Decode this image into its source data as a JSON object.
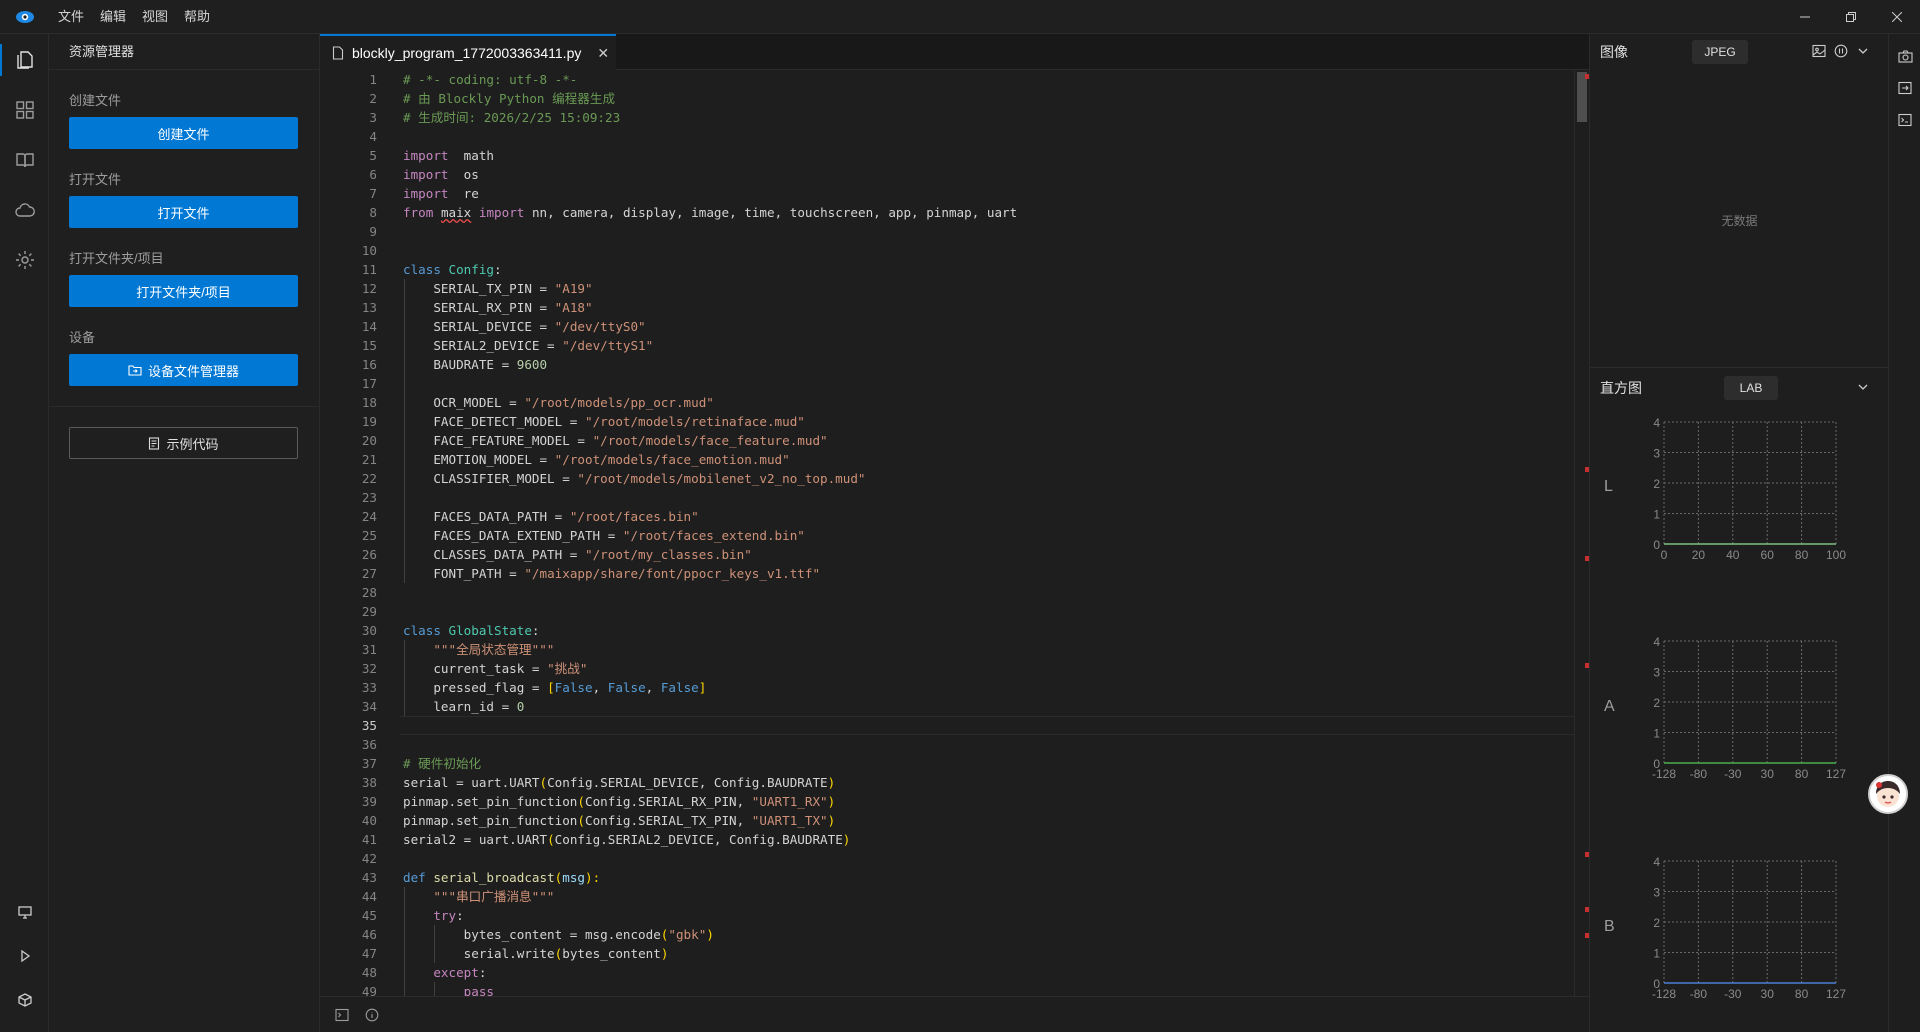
{
  "menu": [
    "文件",
    "编辑",
    "视图",
    "帮助"
  ],
  "sidebar": {
    "title": "资源管理器",
    "sections": [
      {
        "label": "创建文件",
        "button": "创建文件"
      },
      {
        "label": "打开文件",
        "button": "打开文件"
      },
      {
        "label": "打开文件夹/项目",
        "button": "打开文件夹/项目"
      },
      {
        "label": "设备",
        "button": "设备文件管理器"
      }
    ],
    "example_button": "示例代码"
  },
  "editor": {
    "tab_title": "blockly_program_1772003363411.py",
    "current_line": 35,
    "lines": [
      [
        [
          "com",
          "# -*- coding: utf-8 -*-"
        ]
      ],
      [
        [
          "com",
          "# 由 Blockly Python 编程器生成"
        ]
      ],
      [
        [
          "com",
          "# 生成时间: 2026/2/25 15:09:23"
        ]
      ],
      [],
      [
        [
          "kw2",
          "import"
        ],
        [
          "",
          "  math"
        ]
      ],
      [
        [
          "kw2",
          "import"
        ],
        [
          "",
          "  os"
        ]
      ],
      [
        [
          "kw2",
          "import"
        ],
        [
          "",
          "  re"
        ]
      ],
      [
        [
          "kw2",
          "from"
        ],
        [
          "",
          " "
        ],
        [
          "squig",
          "maix"
        ],
        [
          "",
          " "
        ],
        [
          "kw2",
          "import"
        ],
        [
          "",
          " nn, camera, display, image, time, touchscreen, app, pinmap, uart"
        ]
      ],
      [],
      [],
      [
        [
          "kw",
          "class"
        ],
        [
          "",
          " "
        ],
        [
          "cls",
          "Config"
        ],
        [
          "",
          ":"
        ]
      ],
      [
        [
          "",
          "    SERIAL_TX_PIN = "
        ],
        [
          "str",
          "\"A19\""
        ]
      ],
      [
        [
          "",
          "    SERIAL_RX_PIN = "
        ],
        [
          "str",
          "\"A18\""
        ]
      ],
      [
        [
          "",
          "    SERIAL_DEVICE = "
        ],
        [
          "str",
          "\"/dev/ttyS0\""
        ]
      ],
      [
        [
          "",
          "    SERIAL2_DEVICE = "
        ],
        [
          "str",
          "\"/dev/ttyS1\""
        ]
      ],
      [
        [
          "",
          "    BAUDRATE = "
        ],
        [
          "num",
          "9600"
        ]
      ],
      [],
      [
        [
          "",
          "    OCR_MODEL = "
        ],
        [
          "str",
          "\"/root/models/pp_ocr.mud\""
        ]
      ],
      [
        [
          "",
          "    FACE_DETECT_MODEL = "
        ],
        [
          "str",
          "\"/root/models/retinaface.mud\""
        ]
      ],
      [
        [
          "",
          "    FACE_FEATURE_MODEL = "
        ],
        [
          "str",
          "\"/root/models/face_feature.mud\""
        ]
      ],
      [
        [
          "",
          "    EMOTION_MODEL = "
        ],
        [
          "str",
          "\"/root/models/face_emotion.mud\""
        ]
      ],
      [
        [
          "",
          "    CLASSIFIER_MODEL = "
        ],
        [
          "str",
          "\"/root/models/mobilenet_v2_no_top.mud\""
        ]
      ],
      [],
      [
        [
          "",
          "    FACES_DATA_PATH = "
        ],
        [
          "str",
          "\"/root/faces.bin\""
        ]
      ],
      [
        [
          "",
          "    FACES_DATA_EXTEND_PATH = "
        ],
        [
          "str",
          "\"/root/faces_extend.bin\""
        ]
      ],
      [
        [
          "",
          "    CLASSES_DATA_PATH = "
        ],
        [
          "str",
          "\"/root/my_classes.bin\""
        ]
      ],
      [
        [
          "",
          "    FONT_PATH = "
        ],
        [
          "str",
          "\"/maixapp/share/font/ppocr_keys_v1.ttf\""
        ]
      ],
      [],
      [],
      [
        [
          "kw",
          "class"
        ],
        [
          "",
          " "
        ],
        [
          "cls",
          "GlobalState"
        ],
        [
          "",
          ":"
        ]
      ],
      [
        [
          "str",
          "    \"\"\"全局状态管理\"\"\""
        ]
      ],
      [
        [
          "",
          "    current_task = "
        ],
        [
          "str",
          "\"挑战\""
        ]
      ],
      [
        [
          "",
          "    pressed_flag = "
        ],
        [
          "br",
          "["
        ],
        [
          "kw",
          "False"
        ],
        [
          "",
          ", "
        ],
        [
          "kw",
          "False"
        ],
        [
          "",
          ", "
        ],
        [
          "kw",
          "False"
        ],
        [
          "br",
          "]"
        ]
      ],
      [
        [
          "",
          "    learn_id = "
        ],
        [
          "num",
          "0"
        ]
      ],
      [],
      [],
      [
        [
          "com",
          "# 硬件初始化"
        ]
      ],
      [
        [
          "",
          "serial = uart.UART"
        ],
        [
          "br",
          "("
        ],
        [
          "",
          "Config.SERIAL_DEVICE, Config.BAUDRATE"
        ],
        [
          "br",
          ")"
        ]
      ],
      [
        [
          "",
          "pinmap.set_pin_function"
        ],
        [
          "br",
          "("
        ],
        [
          "",
          "Config.SERIAL_RX_PIN, "
        ],
        [
          "str",
          "\"UART1_RX\""
        ],
        [
          "br",
          ")"
        ]
      ],
      [
        [
          "",
          "pinmap.set_pin_function"
        ],
        [
          "br",
          "("
        ],
        [
          "",
          "Config.SERIAL_TX_PIN, "
        ],
        [
          "str",
          "\"UART1_TX\""
        ],
        [
          "br",
          ")"
        ]
      ],
      [
        [
          "",
          "serial2 = uart.UART"
        ],
        [
          "br",
          "("
        ],
        [
          "",
          "Config.SERIAL2_DEVICE, Config.BAUDRATE"
        ],
        [
          "br",
          ")"
        ]
      ],
      [],
      [
        [
          "kw",
          "def"
        ],
        [
          "",
          " "
        ],
        [
          "fn",
          "serial_broadcast"
        ],
        [
          "br",
          "("
        ],
        [
          "par",
          "msg"
        ],
        [
          "br",
          "):"
        ]
      ],
      [
        [
          "str",
          "    \"\"\"串口广播消息\"\"\""
        ]
      ],
      [
        [
          "kw2",
          "    try"
        ],
        [
          "",
          ":"
        ]
      ],
      [
        [
          "",
          "        bytes_content = msg.encode"
        ],
        [
          "br",
          "("
        ],
        [
          "str",
          "\"gbk\""
        ],
        [
          "br",
          ")"
        ]
      ],
      [
        [
          "",
          "        serial.write"
        ],
        [
          "br",
          "("
        ],
        [
          "",
          "bytes_content"
        ],
        [
          "br",
          ")"
        ]
      ],
      [
        [
          "kw2",
          "    except"
        ],
        [
          "",
          ":"
        ]
      ],
      [
        [
          "kw2",
          "        pass"
        ]
      ]
    ]
  },
  "right_panel": {
    "image_title": "图像",
    "image_format": "JPEG",
    "no_data": "无数据",
    "histogram_title": "直方图",
    "histogram_mode": "LAB",
    "channels": [
      {
        "label": "L",
        "x_ticks": [
          "0",
          "20",
          "40",
          "60",
          "80",
          "100"
        ],
        "y_ticks": [
          "0",
          "1",
          "2",
          "3",
          "4"
        ],
        "line_color": "#7fbf7f"
      },
      {
        "label": "A",
        "x_ticks": [
          "-128",
          "-80",
          "-30",
          "30",
          "80",
          "127"
        ],
        "y_ticks": [
          "0",
          "1",
          "2",
          "3",
          "4"
        ],
        "line_color": "#4caf50"
      },
      {
        "label": "B",
        "x_ticks": [
          "-128",
          "-80",
          "-30",
          "30",
          "80",
          "127"
        ],
        "y_ticks": [
          "0",
          "1",
          "2",
          "3",
          "4"
        ],
        "line_color": "#4a7fd4"
      }
    ]
  },
  "colors": {
    "accent": "#0078d4",
    "error_marker": "#c72e2e"
  }
}
